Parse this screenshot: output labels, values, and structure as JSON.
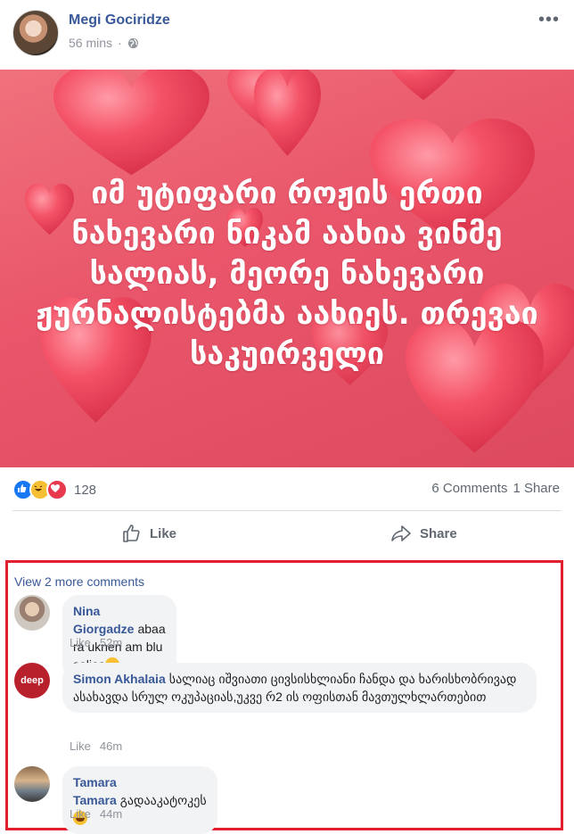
{
  "post": {
    "author": "Megi Gociridze",
    "time": "56 mins",
    "privacy_icon": "globe-icon",
    "menu_icon": "more-options-icon",
    "quote": "იმ უტიფარი როჟის ერთი ნახევარი ნიკამ აახია ვინმე სალიას, მეორე ნახევარი ჟურნალისტებმა აახიეს. თრევაი საკუირველი",
    "reactions": [
      "like",
      "haha",
      "love"
    ],
    "reaction_count": "128",
    "comments_count": "6 Comments",
    "shares_count": "1 Share"
  },
  "actions": {
    "like_label": "Like",
    "share_label": "Share"
  },
  "comments_section": {
    "view_more": "View 2 more comments",
    "items": [
      {
        "name": "Nina Giorgadze",
        "text": "abaa ra uknen am blu salias",
        "like_label": "Like",
        "time": "52m"
      },
      {
        "name": "Simon Akhalaia",
        "text": "სალიაც იშვიათი ცივსისხლიანი ჩანდა და ხარისხობრივად ასახავდა სრულ ოკუპაციას,უკვე რ2 ის ოფისთან მავთულხლართებით",
        "like_label": "Like",
        "time": "46m",
        "avatar_text": "deep"
      },
      {
        "name": "Tamara Tamara",
        "text": "გადააკატოკეს",
        "like_label": "Like",
        "time": "44m"
      }
    ]
  },
  "colors": {
    "link": "#385898",
    "highlight_border": "#e0202d",
    "image_bg": "#e9556a"
  }
}
